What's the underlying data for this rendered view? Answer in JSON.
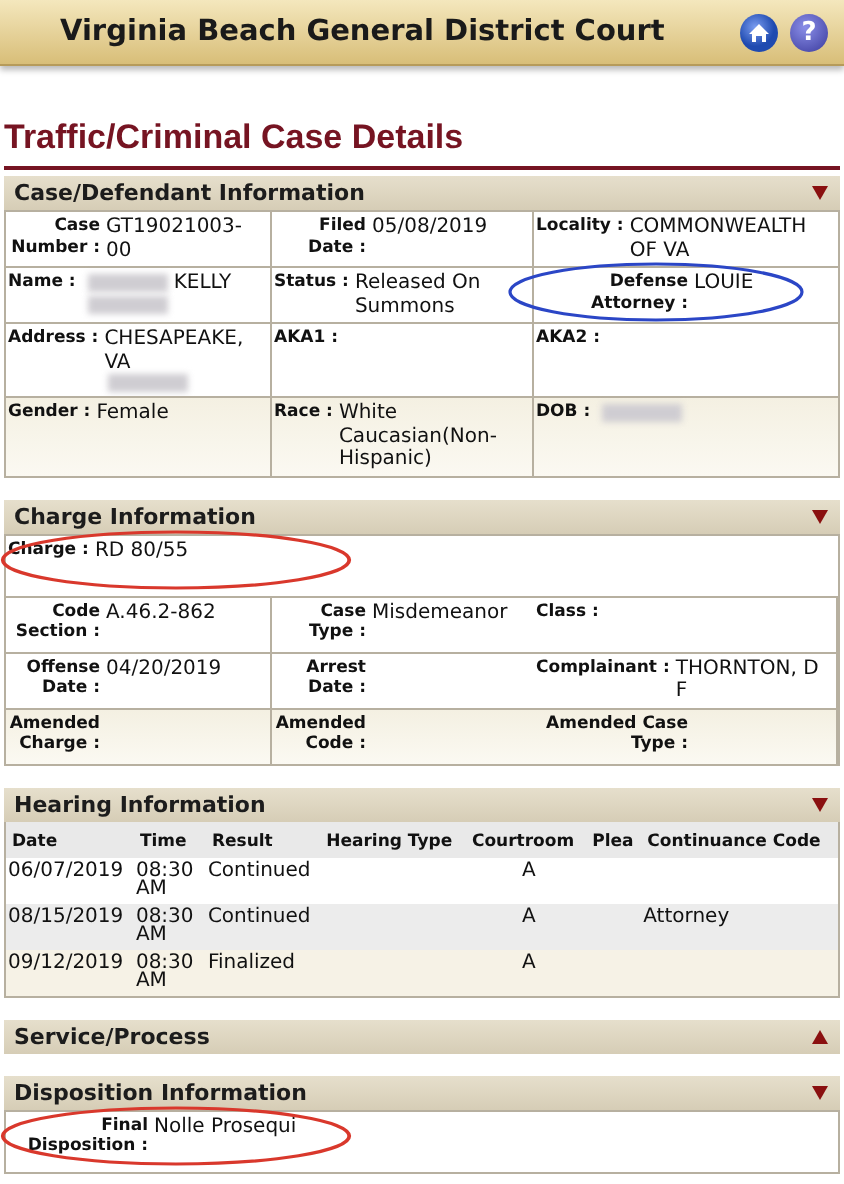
{
  "header": {
    "title": "Virginia Beach General District Court",
    "help_label": "?"
  },
  "page_title": "Traffic/Criminal Case Details",
  "sections": [
    {
      "kind": "fields",
      "title": "Case/Defendant Information",
      "expanded": true,
      "rows": [
        [
          {
            "label": "Case Number :",
            "value": "GT19021003-00"
          },
          {
            "label": "Filed Date :",
            "value": "05/08/2019"
          },
          {
            "label": "Locality :",
            "value": "COMMONWEALTH OF VA"
          }
        ],
        [
          {
            "label": "Name :",
            "parts": [
              {
                "kind": "redacted"
              },
              {
                "kind": "text",
                "text": "KELLY"
              },
              {
                "kind": "redacted"
              }
            ]
          },
          {
            "label": "Status :",
            "value": "Released On Summons"
          },
          {
            "label": "Defense Attorney :",
            "value": "LOUIE",
            "circle": {
              "color": "#2b46c6"
            }
          }
        ],
        [
          {
            "label": "Address :",
            "parts": [
              {
                "kind": "text",
                "text": "CHESAPEAKE, VA"
              },
              {
                "kind": "redacted"
              }
            ]
          },
          {
            "label": "AKA1 :"
          },
          {
            "label": "AKA2 :"
          }
        ],
        [
          {
            "label": "Gender :",
            "value": "Female"
          },
          {
            "label": "Race :",
            "value": "White Caucasian(Non-Hispanic)"
          },
          {
            "label": "DOB :",
            "parts": [
              {
                "kind": "redacted"
              }
            ]
          }
        ]
      ]
    },
    {
      "kind": "fields",
      "title": "Charge Information",
      "expanded": true,
      "rows": [
        [
          {
            "label": "Charge :",
            "value": "RD 80/55",
            "circle": {
              "color": "#d9382c"
            }
          }
        ],
        [
          {
            "label": "Code Section :",
            "value": "A.46.2-862"
          },
          {
            "label": "Case Type :",
            "value": "Misdemeanor"
          },
          {
            "label": "Class :"
          }
        ],
        [
          {
            "label": "Offense Date :",
            "value": "04/20/2019"
          },
          {
            "label": "Arrest Date :"
          },
          {
            "label": "Complainant :",
            "value": "THORNTON, D F"
          }
        ],
        [
          {
            "label": "Amended Charge :"
          },
          {
            "label": "Amended Code :"
          },
          {
            "label": "Amended Case Type :"
          }
        ]
      ]
    },
    {
      "kind": "table",
      "title": "Hearing Information",
      "expanded": true,
      "columns": [
        "Date",
        "Time",
        "Result",
        "Hearing Type",
        "Courtroom",
        "Plea",
        "Continuance Code"
      ],
      "rows": [
        [
          "06/07/2019",
          "08:30 AM",
          "Continued",
          "",
          "A",
          "",
          ""
        ],
        [
          "08/15/2019",
          "08:30 AM",
          "Continued",
          "",
          "A",
          "",
          "Attorney"
        ],
        [
          "09/12/2019",
          "08:30 AM",
          "Finalized",
          "",
          "A",
          "",
          ""
        ]
      ]
    },
    {
      "title": "Service/Process",
      "expanded": false
    },
    {
      "kind": "fields",
      "title": "Disposition Information",
      "expanded": true,
      "rows": [
        [
          {
            "label": "Final Disposition :",
            "value": "Nolle Prosequi",
            "circle": {
              "color": "#d9382c"
            }
          }
        ]
      ]
    }
  ]
}
